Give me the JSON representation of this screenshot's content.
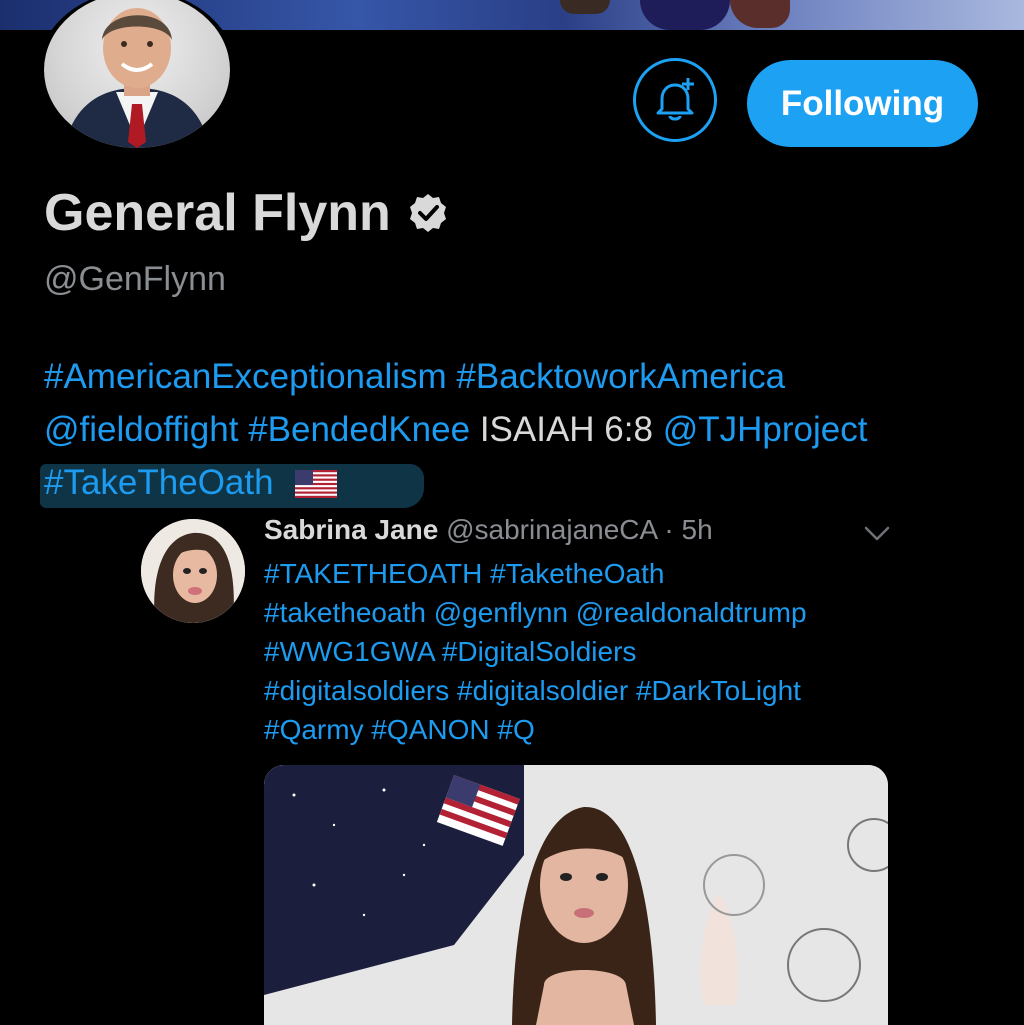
{
  "profile": {
    "display_name": "General Flynn",
    "handle": "@GenFlynn",
    "verified_icon": "verified-badge-icon",
    "avatar": "profile-avatar"
  },
  "actions": {
    "notify_icon": "bell-plus-icon",
    "following_label": "Following"
  },
  "bio": {
    "line1": [
      "#AmericanExceptionalism",
      "#BacktoworkAmerica"
    ],
    "line2": {
      "mention1": "@fieldoffight",
      "tag": "#BendedKnee",
      "text": "ISAIAH 6:8",
      "mention2": "@TJHproject"
    },
    "line3": {
      "tag": "#TakeTheOath",
      "flag_icon": "us-flag-icon"
    }
  },
  "reply": {
    "name": "Sabrina Jane",
    "handle": "@sabrinajaneCA",
    "separator": "·",
    "time": "5h",
    "chevron_icon": "chevron-down-icon",
    "lines": [
      "#TAKETHEOATH #TaketheOath",
      "#taketheoath @genflynn @realdonaldtrump",
      "#WWG1GWA #DigitalSoldiers",
      "#digitalsoldiers #digitalsoldier #DarkToLight",
      "#Qarmy #QANON #Q"
    ]
  },
  "colors": {
    "accent": "#1da1f2",
    "link": "#1d9bf0",
    "background": "#000000",
    "text": "#d9d9d9",
    "muted": "#8a8d91"
  }
}
